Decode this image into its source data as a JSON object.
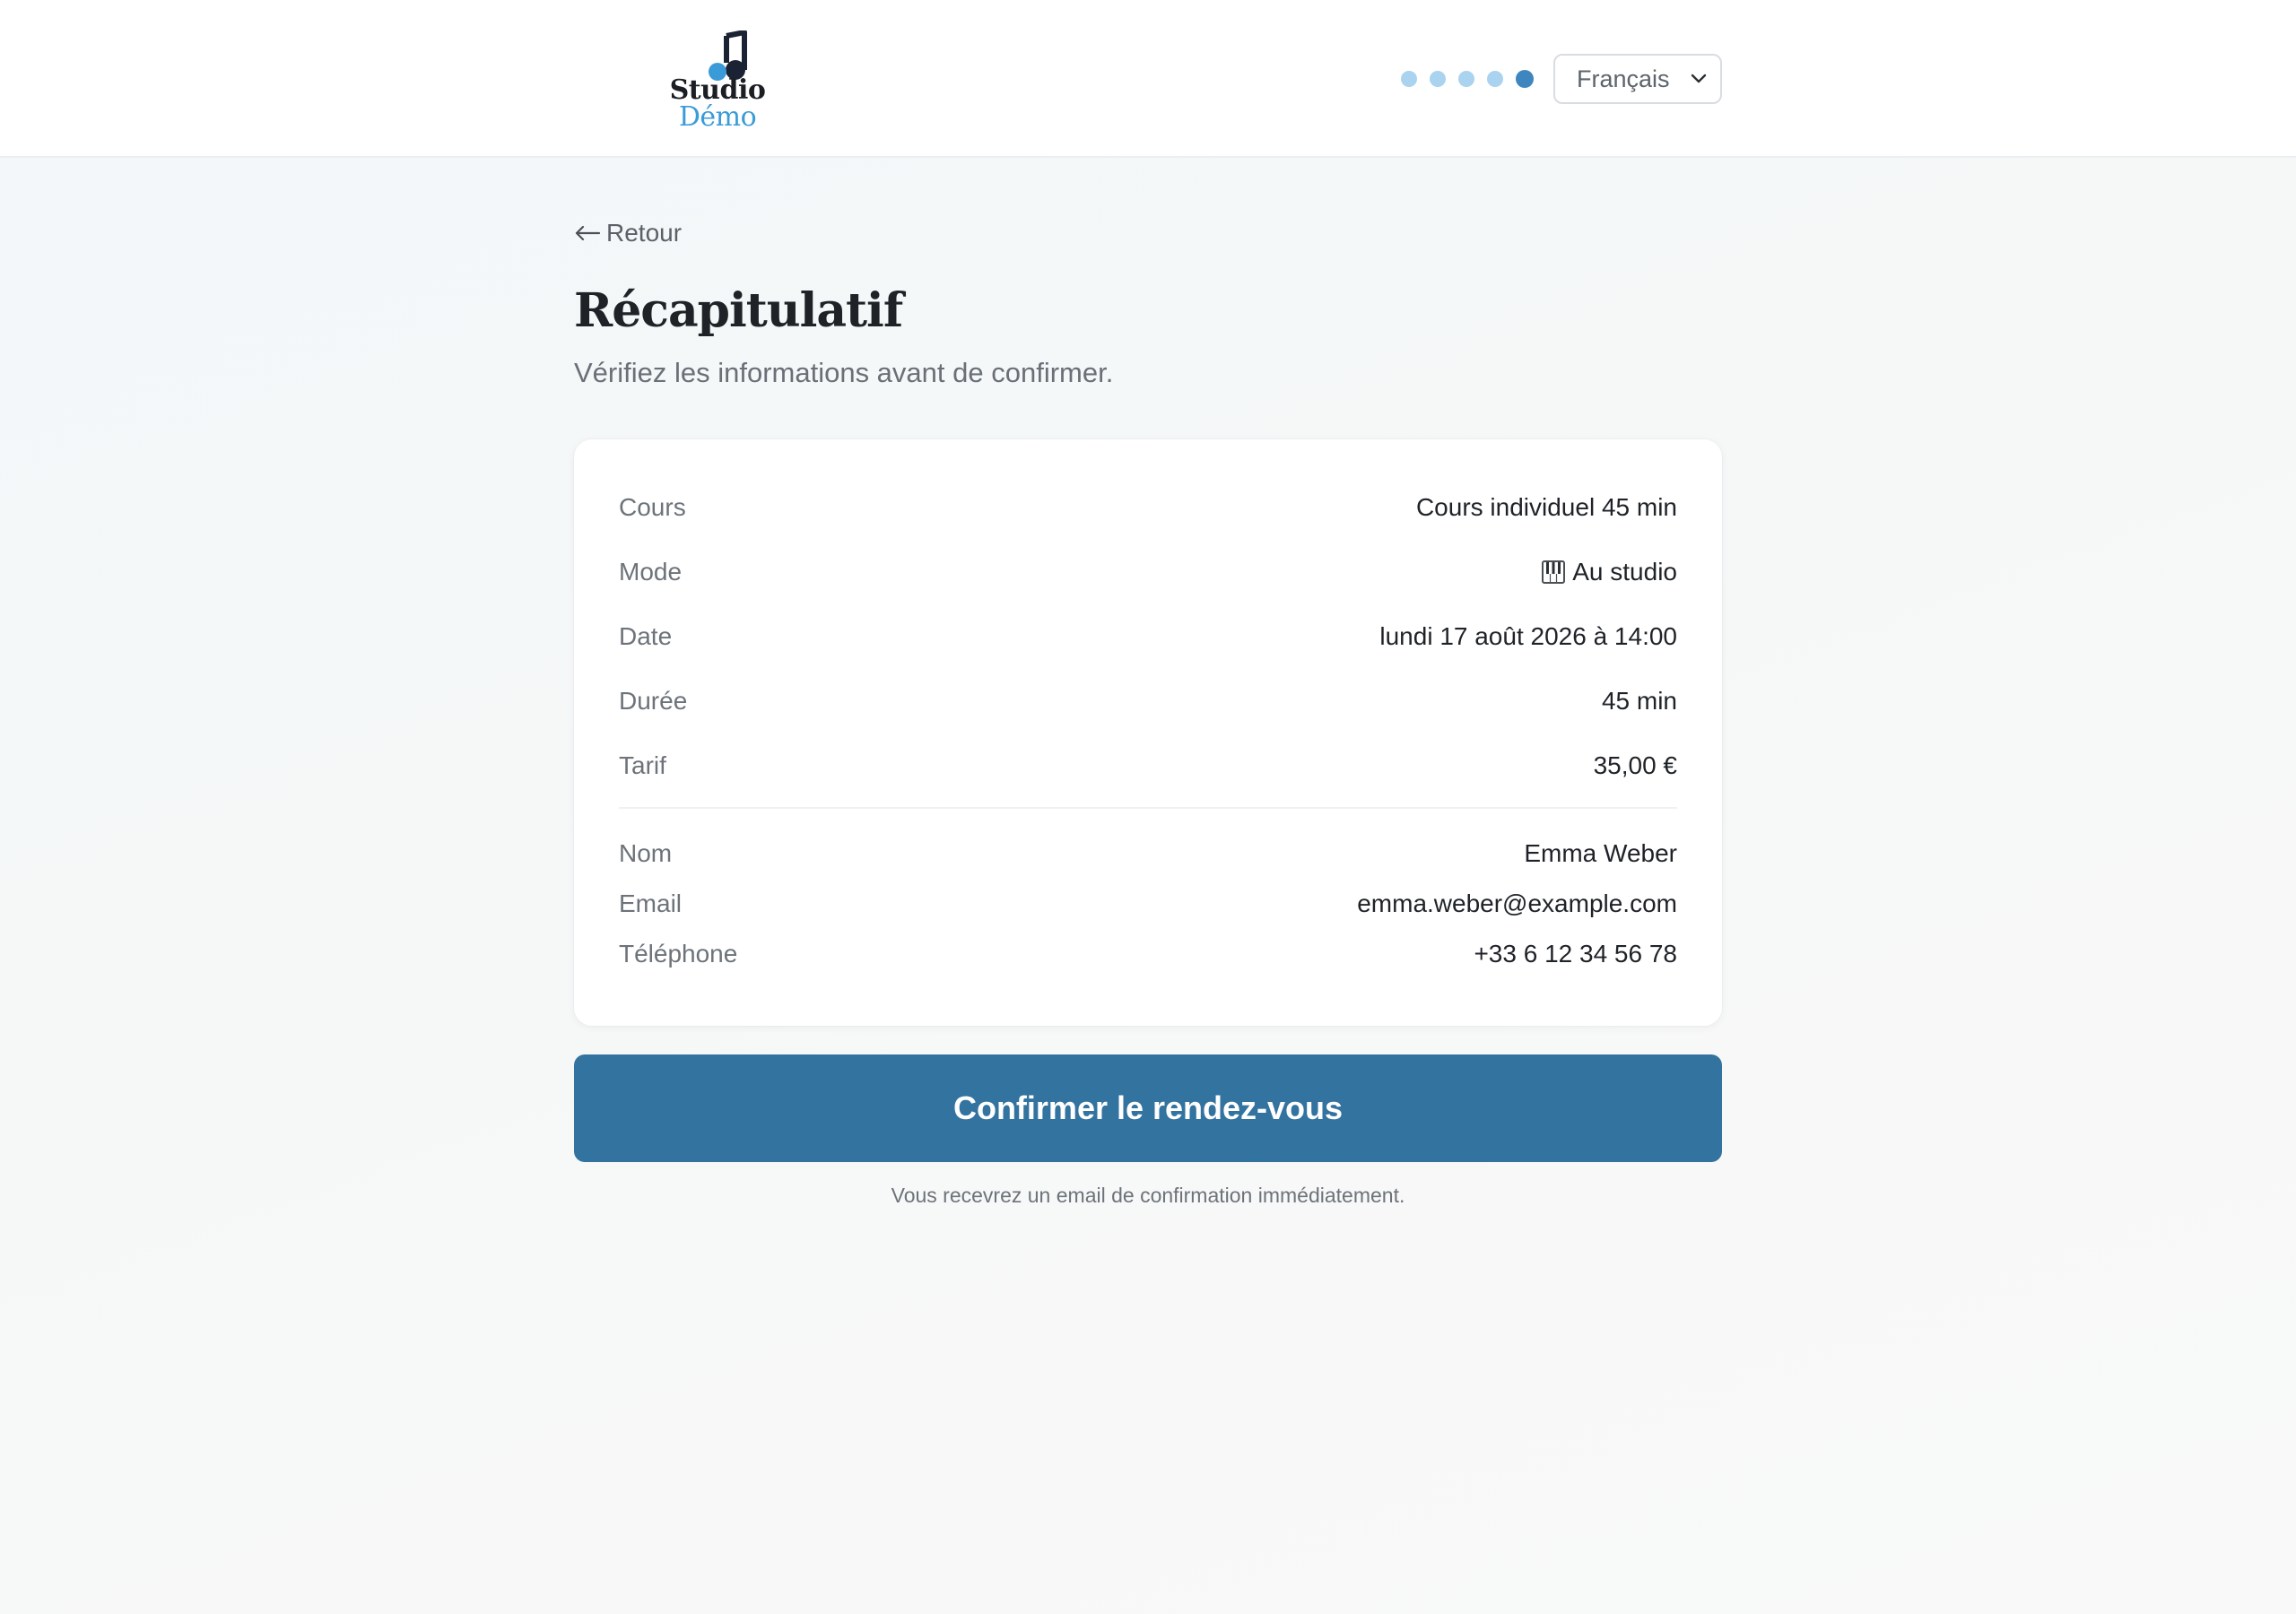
{
  "header": {
    "logo": {
      "line1": "Studio",
      "line2": "Démo",
      "icon": "music-note-icon"
    },
    "steps": {
      "total": 5,
      "current": 5
    },
    "language": {
      "selected": "Français"
    }
  },
  "colors": {
    "accent": "#33739f",
    "logo_blue": "#3a9bd8",
    "step_inactive": "#a9d3ee",
    "step_active": "#3f86bf"
  },
  "page": {
    "back_label": "Retour",
    "title": "Récapitulatif",
    "subtitle": "Vérifiez les informations avant de confirmer."
  },
  "summary": {
    "booking": [
      {
        "label": "Cours",
        "value": "Cours individuel 45 min"
      },
      {
        "label": "Mode",
        "value": "Au studio",
        "icon": "piano-icon"
      },
      {
        "label": "Date",
        "value": "lundi 17 août 2026 à 14:00"
      },
      {
        "label": "Durée",
        "value": "45 min"
      },
      {
        "label": "Tarif",
        "value": "35,00 €"
      }
    ],
    "contact": [
      {
        "label": "Nom",
        "value": "Emma Weber"
      },
      {
        "label": "Email",
        "value": "emma.weber@example.com"
      },
      {
        "label": "Téléphone",
        "value": "+33 6 12 34 56 78"
      }
    ]
  },
  "actions": {
    "confirm_label": "Confirmer le rendez-vous",
    "footnote": "Vous recevrez un email de confirmation immédiatement."
  }
}
